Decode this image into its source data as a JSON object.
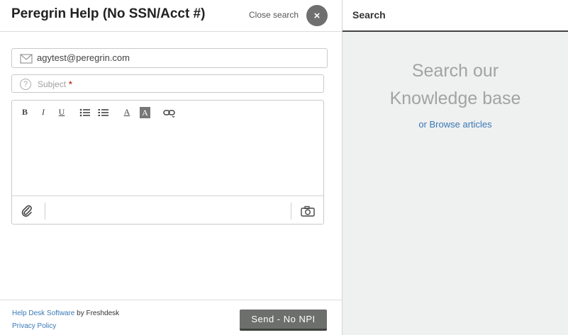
{
  "header": {
    "title": "Peregrin Help (No SSN/Acct #)",
    "close_search_label": "Close search",
    "close_icon": "×"
  },
  "form": {
    "email_value": "agytest@peregrin.com",
    "subject_placeholder": "Subject",
    "subject_required_mark": "*",
    "toolbar": {
      "bold": "B",
      "italic": "I",
      "underline": "U",
      "font_color": "A",
      "bg_color": "A"
    }
  },
  "footer": {
    "help_desk_link": "Help Desk Software",
    "by_text": " by Freshdesk",
    "privacy_link": "Privacy Policy",
    "send_label": "Send - No NPI"
  },
  "search_panel": {
    "title": "Search",
    "kb_line1": "Search our",
    "kb_line2": "Knowledge base",
    "browse_link": "or Browse articles"
  },
  "icons": [
    "envelope-icon",
    "question-icon",
    "bullet-list-icon",
    "numbered-list-icon",
    "link-icon",
    "paperclip-icon",
    "camera-icon",
    "close-icon"
  ],
  "colors": {
    "link": "#3a78b5",
    "send_button": "#6c6f6c",
    "right_panel_bg": "#eff0f0",
    "required": "#c0392b"
  }
}
